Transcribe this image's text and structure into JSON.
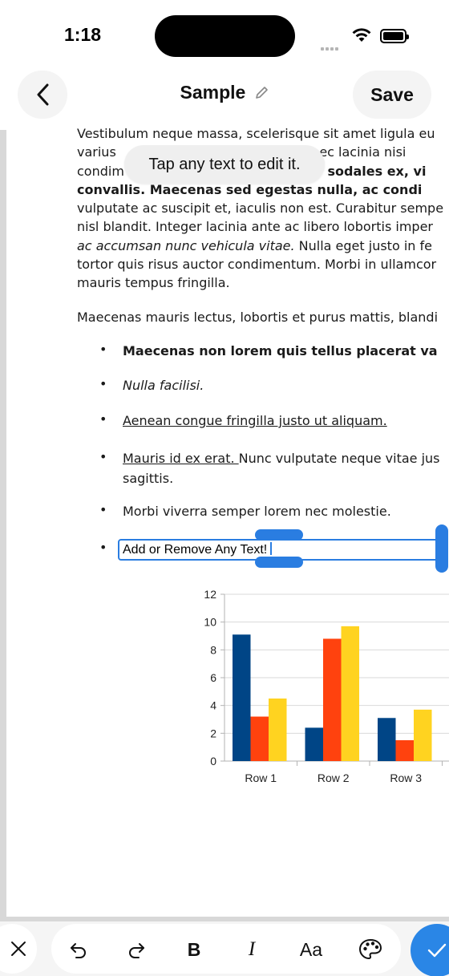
{
  "status_bar": {
    "time": "1:18"
  },
  "nav": {
    "title": "Sample",
    "save_label": "Save"
  },
  "tooltip": {
    "text": "Tap any text to edit it."
  },
  "document": {
    "p1": {
      "l1": "Vestibulum neque massa, scelerisque sit amet ligula eu",
      "l2a": "varius ",
      "l2b": "u, nec lacinia nisi",
      "l3a": "condim",
      "l3b": " sodales ex, vi",
      "l4": "convallis. Maecenas sed egestas nulla, ac condi",
      "l5": "vulputate ac suscipit et, iaculis non est. Curabitur sempe",
      "l6": "nisl blandit. Integer lacinia ante ac libero lobortis imper",
      "l7a": "ac accumsan nunc vehicula vitae.",
      "l7b": " Nulla eget justo in fe",
      "l8": "tortor quis risus auctor condimentum. Morbi in ullamcor",
      "l9": "mauris tempus fringilla."
    },
    "p2": "Maecenas mauris lectus, lobortis et purus mattis, blandi",
    "bullet_symbol": "•",
    "bullets": [
      {
        "text": "Maecenas non lorem quis tellus placerat va"
      },
      {
        "text": "Nulla facilisi."
      },
      {
        "text": "Aenean congue fringilla justo ut aliquam. "
      },
      {
        "text_underlined": "Mauris id ex erat. ",
        "text_rest": "Nunc vulputate neque vitae jus",
        "text_line2": "sagittis."
      },
      {
        "text": "Morbi viverra semper lorem nec molestie."
      }
    ],
    "edit_field_value": "Add or Remove Any Text!"
  },
  "chart_data": {
    "type": "bar",
    "categories": [
      "Row 1",
      "Row 2",
      "Row 3"
    ],
    "series": [
      {
        "color": "#004586",
        "values": [
          9.1,
          2.4,
          3.1
        ]
      },
      {
        "color": "#ff420e",
        "values": [
          3.2,
          8.8,
          1.5
        ]
      },
      {
        "color": "#ffd320",
        "values": [
          4.5,
          9.7,
          3.7
        ]
      }
    ],
    "yticks": [
      "0",
      "2",
      "4",
      "6",
      "8",
      "10",
      "12"
    ],
    "ylim": [
      0,
      12
    ],
    "grid": true
  },
  "toolbar": {
    "bold_label": "B",
    "italic_label": "I",
    "font_label": "Aa"
  },
  "colors": {
    "accent": "#2a7de1",
    "confirm": "#2a86e6"
  }
}
